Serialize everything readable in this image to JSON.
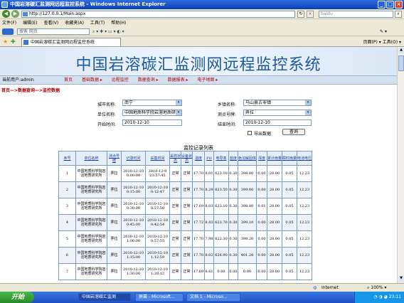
{
  "window": {
    "title": "中国岩溶碳汇监测网远程监控系统 - Windows Internet Explorer"
  },
  "browser": {
    "address": "http://127.0.0.1/Main.aspx",
    "search_placeholder": "baidu",
    "menu": [
      "文件(F)",
      "编辑(E)",
      "查看(V)",
      "收藏夹(A)",
      "工具(T)",
      "帮助(H)"
    ],
    "links_search_placeholder": "搜索 网页",
    "tab_title": "中国岩溶碳汇监测网远程监控系统",
    "right_tools": "页面(P) ▾  工具(O) ▾"
  },
  "page": {
    "banner_title": "中国岩溶碳汇监测网远程监控系统",
    "current_user": "当前用户:admin",
    "nav": [
      "首页",
      "基础数据 ▸",
      "远程监控",
      "数据查询 ▸",
      "数据报表 ▸",
      "电子地图 ▸"
    ],
    "breadcrumb": "首页—>数据查询—>监控数据",
    "form": {
      "city_label": "城市名称:",
      "city_value": "南宁",
      "town_label": "乡镇名称:",
      "town_value": "马山县古零镇",
      "unit_label": "单位名称:",
      "unit_value": "中国地质科学院岩溶地质研",
      "station_label": "测点号牌:",
      "station_value": "弄拉",
      "start_label": "开始时间:",
      "start_value": "2010-12-10",
      "end_label": "结束时间:",
      "end_value": "2010-12-10",
      "export_label": "导出数据",
      "query_button": "查询"
    },
    "table_title": "监控记录列表",
    "table_headers": [
      "序号",
      "单位名称",
      "测点号牌",
      "记录时间",
      "采集时间",
      "采样状态",
      "设备状态",
      "温度",
      "PH",
      "电导率",
      "盐度",
      "色溶解固体",
      "浑度",
      "累计雨量",
      "瞬时雨量",
      "电池电压"
    ],
    "rows": [
      [
        "1",
        "中国地质科学院岩溶地质研究所",
        "弄拉",
        "2010-12-10 0:00:00",
        "2010-12-9 23:57:45",
        "正常",
        "正常",
        "17.70",
        "8.01",
        "623.10",
        "0.30",
        "398.80",
        "0.00",
        "28.00",
        "0.05",
        "12.23"
      ],
      [
        "2",
        "中国地质科学院岩溶地质研究所",
        "弄拉",
        "2010-12-10 0:15:00",
        "2010-12-10 0:12:47",
        "正常",
        "正常",
        "17.70",
        "8.29",
        "623.50",
        "0.30",
        "399.00",
        "0.00",
        "28.00",
        "0.05",
        "12.23"
      ],
      [
        "3",
        "中国地质科学院岩溶地质研究所",
        "弄拉",
        "2010-12-10 0:30:00",
        "2010-12-10 0:27:50",
        "正常",
        "正常",
        "17.69",
        "8.03",
        "623.10",
        "0.30",
        "398.80",
        "0.01",
        "28.00",
        "0.05",
        "12.23"
      ],
      [
        "4",
        "中国地质科学院岩溶地质研究所",
        "弄拉",
        "2010-12-10 0:45:00",
        "2010-12-10 0:42:54",
        "正常",
        "正常",
        "17.72",
        "8.03",
        "623.70",
        "0.30",
        "399.10",
        "0.00",
        "28.00",
        "0.05",
        "12.23"
      ],
      [
        "5",
        "中国地质科学院岩溶地质研究所",
        "弄拉",
        "2010-12-10 1:00:00",
        "2010-12-10 0:57:55",
        "正常",
        "正常",
        "17.70",
        "7.98",
        "622.30",
        "0.30",
        "398.20",
        "0.00",
        "28.00",
        "0.05",
        "12.23"
      ],
      [
        "6",
        "中国地质科学院岩溶地质研究所",
        "弄拉",
        "2010-12-10 1:15:00",
        "2010-12-10 1:12:59",
        "正常",
        "正常",
        "17.70",
        "8.02",
        "626.90",
        "0.30",
        "401.20",
        "0.00",
        "28.00",
        "0.05",
        "12.23"
      ],
      [
        "7",
        "中国地质科学院岩溶地质研究所",
        "弄拉",
        "2010-12-10 1:30:00",
        "2010-12-10 1:28:12",
        "正常",
        "正常",
        "17.69",
        "8.61",
        "0.00",
        "0.00",
        "0.00",
        "0.00",
        "28.00",
        "0.05",
        "12.23"
      ]
    ]
  },
  "statusbar": {
    "zone": "Internet",
    "zoom": "100%"
  },
  "taskbar": {
    "start": "开始",
    "tasks": [
      "中国岩溶碳汇监测",
      "屏幕 - Microsoft...",
      "文档 1 - Microso..."
    ],
    "clock": "23:11"
  }
}
